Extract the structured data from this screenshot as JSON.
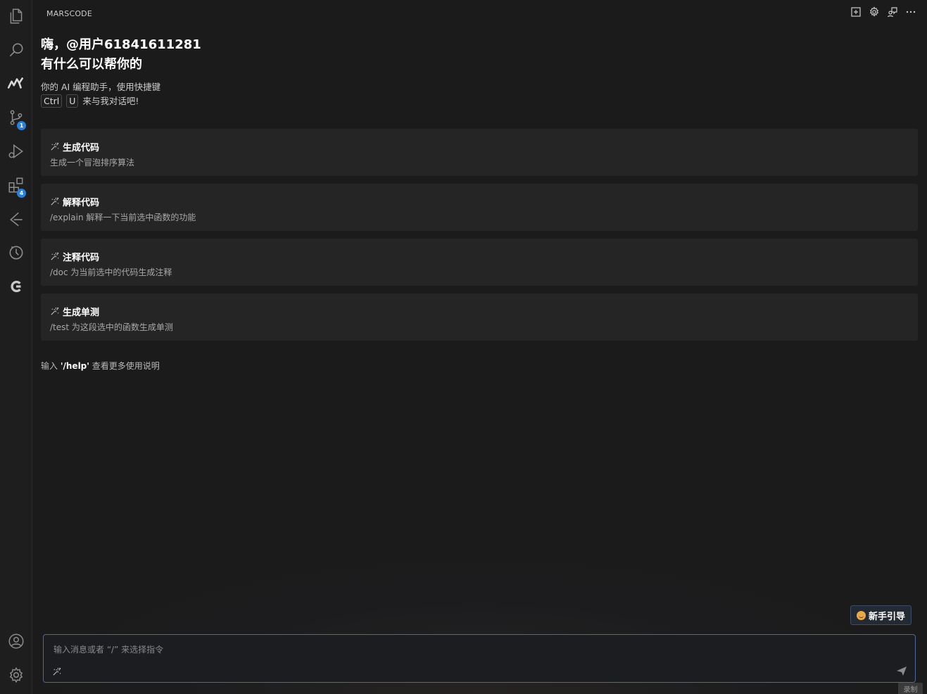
{
  "panel": {
    "title": "MARSCODE"
  },
  "activity_bar": {
    "items": [
      {
        "icon": "files-icon"
      },
      {
        "icon": "search-icon"
      },
      {
        "icon": "marscode-icon"
      },
      {
        "icon": "source-control-icon",
        "badge": "1"
      },
      {
        "icon": "run-debug-icon"
      },
      {
        "icon": "extensions-icon",
        "badge": "4"
      },
      {
        "icon": "git-graph-icon"
      },
      {
        "icon": "timeline-icon"
      },
      {
        "icon": "copilot-icon"
      }
    ],
    "bottom": [
      {
        "icon": "account-icon"
      },
      {
        "icon": "settings-gear-icon"
      }
    ]
  },
  "header_actions": [
    "new-chat-icon",
    "settings-icon",
    "feedback-icon",
    "more-icon"
  ],
  "welcome": {
    "greeting_line1": "嗨，@用户61841611281",
    "greeting_line2": "有什么可以帮你的",
    "subtitle_line1": "你的 AI 编程助手，使用快捷键",
    "key1": "Ctrl",
    "key2": "U",
    "subtitle_line2_tail": " 来与我对话吧!"
  },
  "cards": [
    {
      "title": "生成代码",
      "desc": "生成一个冒泡排序算法"
    },
    {
      "title": "解释代码",
      "desc": "/explain 解释一下当前选中函数的功能"
    },
    {
      "title": "注释代码",
      "desc": "/doc 为当前选中的代码生成注释"
    },
    {
      "title": "生成单测",
      "desc": "/test 为这段选中的函数生成单测"
    }
  ],
  "help_hint": {
    "prefix": "输入 ",
    "command": "'/help'",
    "suffix": " 查看更多使用说明"
  },
  "guide_button": {
    "label": "新手引导"
  },
  "input": {
    "placeholder": "输入消息或者 “/” 来选择指令",
    "value": ""
  },
  "record_tag": "录制",
  "colors": {
    "background": "#1b1b1c",
    "card": "#252526",
    "accent_blue": "#2b7fd8",
    "input_border": "#4a6a9a"
  }
}
